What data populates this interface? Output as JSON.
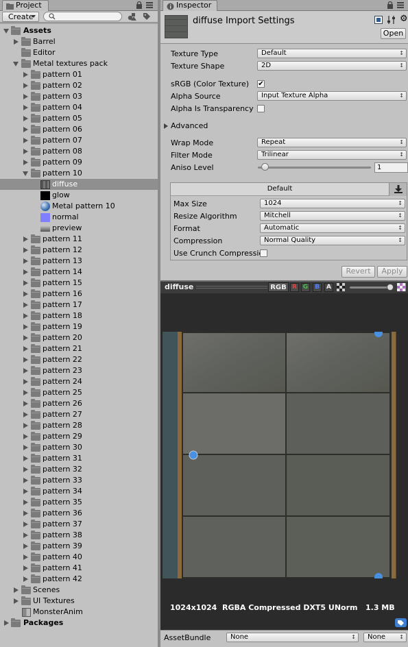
{
  "project": {
    "tab_label": "Project",
    "create_label": "Create",
    "search_placeholder": ""
  },
  "tree": {
    "assets": "Assets",
    "barrel": "Barrel",
    "editor": "Editor",
    "pack": "Metal textures pack",
    "patterns_before": [
      "pattern 01",
      "pattern 02",
      "pattern 03",
      "pattern 04",
      "pattern 05",
      "pattern 06",
      "pattern 07",
      "pattern 08",
      "pattern 09"
    ],
    "pattern10": "pattern 10",
    "children": [
      "diffuse",
      "glow",
      "Metal pattern 10",
      "normal",
      "preview"
    ],
    "patterns_after": [
      "pattern 11",
      "pattern 12",
      "pattern 13",
      "pattern 14",
      "pattern 15",
      "pattern 16",
      "pattern 17",
      "pattern 18",
      "pattern 19",
      "pattern 20",
      "pattern 21",
      "pattern 22",
      "pattern 23",
      "pattern 24",
      "pattern 25",
      "pattern 26",
      "pattern 27",
      "pattern 28",
      "pattern 29",
      "pattern 30",
      "pattern 31",
      "pattern 32",
      "pattern 33",
      "pattern 34",
      "pattern 35",
      "pattern 36",
      "pattern 37",
      "pattern 38",
      "pattern 39",
      "pattern 40",
      "pattern 41",
      "pattern 42"
    ],
    "scenes": "Scenes",
    "ui_textures": "UI Textures",
    "monster": "MonsterAnim",
    "packages": "Packages"
  },
  "inspector": {
    "tab_label": "Inspector",
    "title": "diffuse Import Settings",
    "open_label": "Open",
    "texture_type_label": "Texture Type",
    "texture_type_value": "Default",
    "texture_shape_label": "Texture Shape",
    "texture_shape_value": "2D",
    "srgb_label": "sRGB (Color Texture)",
    "srgb_checked": true,
    "alpha_source_label": "Alpha Source",
    "alpha_source_value": "Input Texture Alpha",
    "alpha_transp_label": "Alpha Is Transparency",
    "advanced_label": "Advanced",
    "wrap_label": "Wrap Mode",
    "wrap_value": "Repeat",
    "filter_label": "Filter Mode",
    "filter_value": "Trilinear",
    "aniso_label": "Aniso Level",
    "aniso_value": "1",
    "aniso_level": 1,
    "platform_tab": "Default",
    "maxsize_label": "Max Size",
    "maxsize_value": "1024",
    "resize_label": "Resize Algorithm",
    "resize_value": "Mitchell",
    "format_label": "Format",
    "format_value": "Automatic",
    "compression_label": "Compression",
    "compression_value": "Normal Quality",
    "crunch_label": "Use Crunch Compression",
    "revert_label": "Revert",
    "apply_label": "Apply"
  },
  "preview": {
    "name": "diffuse",
    "rgb": "RGB",
    "r": "R",
    "g": "G",
    "b": "B",
    "a": "A",
    "info": "1024x1024  RGBA Compressed DXT5 UNorm   1.3 MB",
    "assetbundle_label": "AssetBundle",
    "assetbundle_value": "None",
    "variant_value": "None"
  },
  "colors": {
    "selection": "#8f8f8f",
    "preview_bg": "#2b2b2b",
    "accent_blue": "#4a90e2"
  }
}
